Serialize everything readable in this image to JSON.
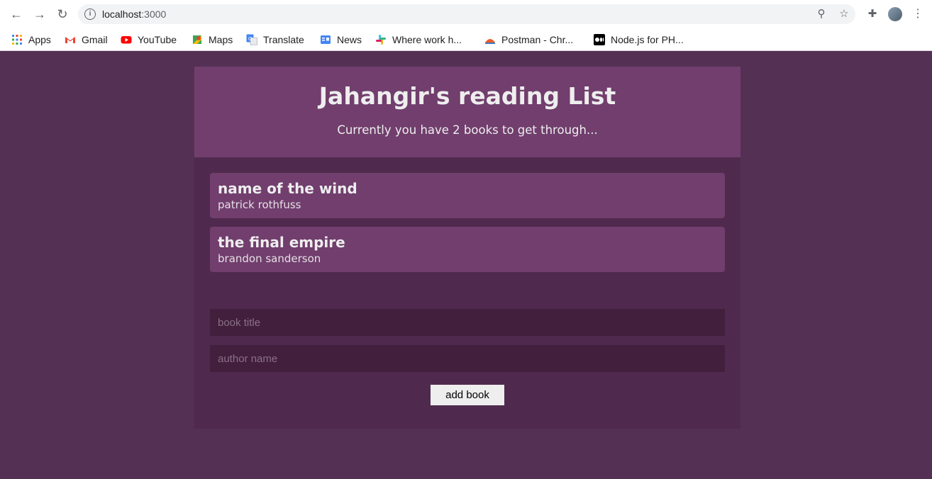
{
  "browser": {
    "url_host": "localhost",
    "url_port": ":3000"
  },
  "bookmarks": [
    {
      "label": "Apps",
      "icon": "apps-grid-icon"
    },
    {
      "label": "Gmail",
      "icon": "gmail-icon"
    },
    {
      "label": "YouTube",
      "icon": "youtube-icon"
    },
    {
      "label": "Maps",
      "icon": "maps-icon"
    },
    {
      "label": "Translate",
      "icon": "translate-icon"
    },
    {
      "label": "News",
      "icon": "news-icon"
    },
    {
      "label": "Where work h...",
      "icon": "slack-icon"
    },
    {
      "label": "Postman - Chr...",
      "icon": "postman-icon"
    },
    {
      "label": "Node.js for PH...",
      "icon": "medium-icon"
    }
  ],
  "app": {
    "title": "Jahangir's reading List",
    "subtitle": "Currently you have 2 books to get through...",
    "books": [
      {
        "title": "name of the wind",
        "author": "patrick rothfuss"
      },
      {
        "title": "the final empire",
        "author": "brandon sanderson"
      }
    ],
    "form": {
      "title_placeholder": "book title",
      "author_placeholder": "author name",
      "submit_label": "add book"
    }
  },
  "colors": {
    "page_bg": "#553055",
    "panel_bg": "#4f2a4e",
    "accent": "#713e6d",
    "input_bg": "#421f3d",
    "text": "#eeeeee"
  }
}
